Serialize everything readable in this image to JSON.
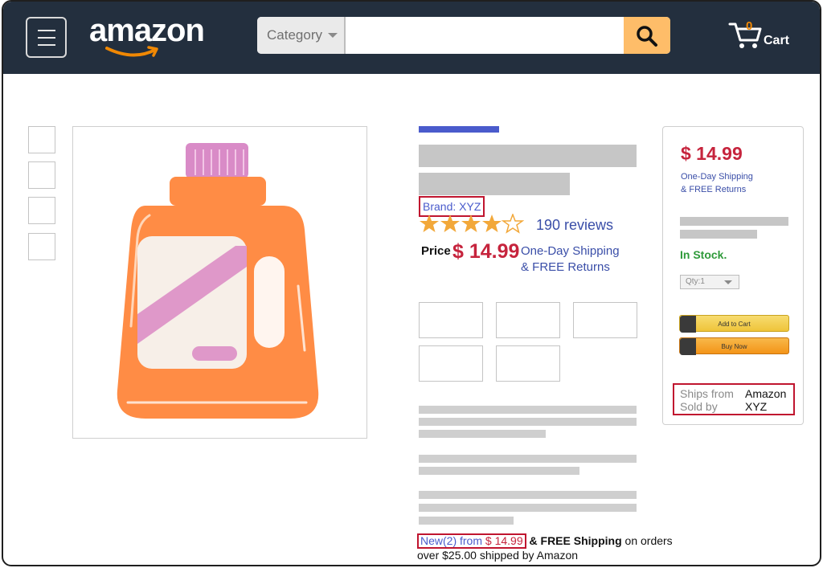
{
  "header": {
    "logo_text": "amazon",
    "search": {
      "category_label": "Category",
      "placeholder": ""
    },
    "cart": {
      "count": "0",
      "label": "Cart"
    }
  },
  "product": {
    "brand": "Brand: XYZ",
    "rating_stars": 4,
    "rating_max": 5,
    "reviews": "190 reviews",
    "price_label": "Price",
    "price": "$ 14.99",
    "shipping_line1": "One-Day Shipping",
    "shipping_line2": "& FREE Returns"
  },
  "buybox": {
    "price": "$ 14.99",
    "shipping_line1": "One-Day Shipping",
    "shipping_line2": "& FREE Returns",
    "stock": "In Stock.",
    "qty": "Qty:1",
    "add_to_cart": "Add to Cart",
    "buy_now": "Buy Now",
    "ships_from_label": "Ships from",
    "ships_from_value": "Amazon",
    "sold_by_label": "Sold by",
    "sold_by_value": "XYZ"
  },
  "offers": {
    "new_prefix": "New(2) from ",
    "new_price": "$ 14.99",
    "free_shipping": "& FREE",
    "shipping_word": "Shipping",
    "tail": " on orders over $25.00 shipped by Amazon"
  },
  "colors": {
    "header_bg": "#232f3e",
    "accent": "#4a5bcc",
    "price": "#c6243d",
    "stock": "#2f9a3a",
    "search_button": "#febd69",
    "highlight_border": "#c0152f"
  },
  "icons": [
    "menu-icon",
    "search-icon",
    "cart-icon",
    "star-icon",
    "bottle-image",
    "cart-small-icon",
    "play-icon"
  ]
}
